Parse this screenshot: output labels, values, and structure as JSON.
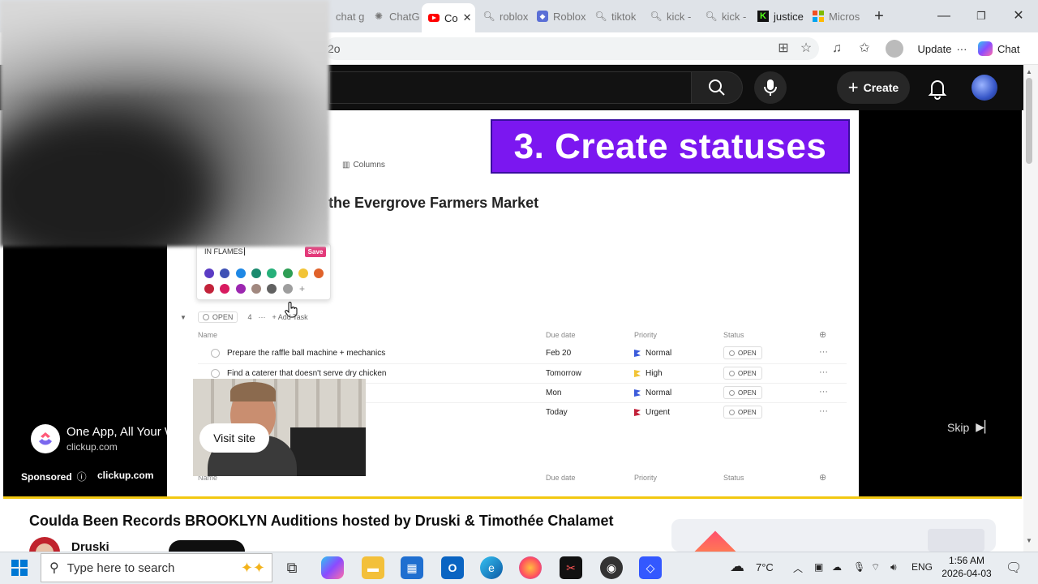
{
  "browser": {
    "tabs": [
      {
        "label": "chat g",
        "icon": "edge-icon"
      },
      {
        "label": "ChatG",
        "icon": "chatgpt-icon"
      },
      {
        "label": "Co",
        "icon": "youtube-icon",
        "active": true
      },
      {
        "label": "roblox",
        "icon": "search-icon"
      },
      {
        "label": "Roblox",
        "icon": "roblox-icon"
      },
      {
        "label": "tiktok",
        "icon": "search-icon"
      },
      {
        "label": "kick - ",
        "icon": "search-icon"
      },
      {
        "label": "kick - ",
        "icon": "search-icon"
      },
      {
        "label": "justice",
        "icon": "kick-icon"
      },
      {
        "label": "Micros",
        "icon": "microsoft-icon"
      }
    ],
    "url_fragment": "2o",
    "update_label": "Update",
    "chat_label": "Chat"
  },
  "youtube": {
    "create_label": "Create"
  },
  "video_frame": {
    "banner": "3. Create statuses",
    "columns_label": "Columns",
    "list_title": "the Evergrove Farmers Market",
    "popup": {
      "status_input": "IN FLAMES",
      "save_label": "Save",
      "swatches_row1": [
        "#5b3cc4",
        "#3f51b5",
        "#1e88e5",
        "#1a8a6e",
        "#26b07a",
        "#2e9e55",
        "#f2c437",
        "#e0622a"
      ],
      "swatches_row2": [
        "#c2223a",
        "#d81b60",
        "#9c27b0",
        "#a1887f",
        "#616161",
        "#9e9e9e"
      ],
      "add_label": "+"
    },
    "group": {
      "status": "OPEN",
      "count": "4",
      "more": "···",
      "add_task": "+ Add Task"
    },
    "columns": {
      "name": "Name",
      "due": "Due date",
      "priority": "Priority",
      "status": "Status"
    },
    "rows": [
      {
        "name": "Prepare the raffle ball machine + mechanics",
        "due": "Feb 20",
        "priority": "Normal",
        "flag": "#3b5bdb",
        "status": "OPEN"
      },
      {
        "name": "Find a caterer that doesn't serve dry chicken",
        "due": "Tomorrow",
        "priority": "High",
        "flag": "#f2c437",
        "status": "OPEN"
      },
      {
        "name": "",
        "due": "Mon",
        "priority": "Normal",
        "flag": "#3b5bdb",
        "status": "OPEN"
      },
      {
        "name": "",
        "due": "Today",
        "priority": "Urgent",
        "flag": "#c2223a",
        "status": "OPEN"
      }
    ],
    "bottom_columns": {
      "name": "Name",
      "due": "Due date",
      "priority": "Priority",
      "status": "Status"
    }
  },
  "ad": {
    "title": "One App, All Your Work",
    "domain": "clickup.com",
    "visit_label": "Visit site",
    "sponsored_label": "Sponsored",
    "sponsor_domain": "clickup.com",
    "skip_label": "Skip"
  },
  "video": {
    "title": "Coulda Been Records BROOKLYN Auditions hosted by Druski & Timothée Chalamet",
    "channel": "Druski"
  },
  "taskbar": {
    "search_placeholder": "Type here to search",
    "temperature": "7°C",
    "language": "ENG",
    "time": "1:56 AM",
    "date": "2026-04-03"
  }
}
